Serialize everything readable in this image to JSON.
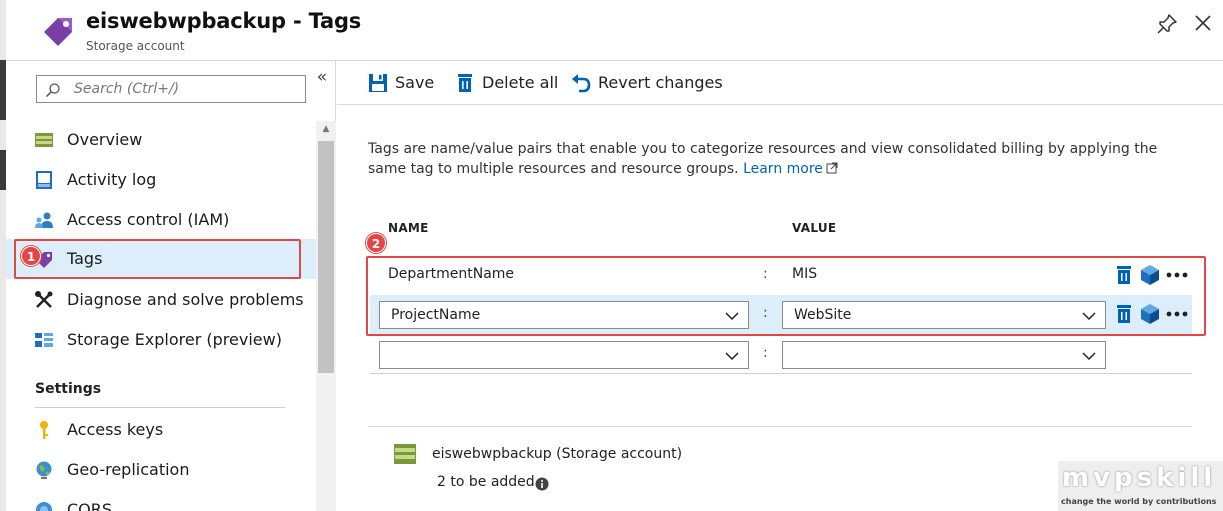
{
  "header": {
    "title": "eiswebwpbackup - Tags",
    "subtitle": "Storage account"
  },
  "sidebar": {
    "search_placeholder": "Search (Ctrl+/)",
    "collapse_glyph": "«",
    "items": [
      {
        "label": "Overview",
        "icon": "storage-overview-icon"
      },
      {
        "label": "Activity log",
        "icon": "activity-log-icon"
      },
      {
        "label": "Access control (IAM)",
        "icon": "people-icon"
      },
      {
        "label": "Tags",
        "icon": "tag-icon",
        "selected": true
      },
      {
        "label": "Diagnose and solve problems",
        "icon": "wrench-icon"
      },
      {
        "label": "Storage Explorer (preview)",
        "icon": "storage-explorer-icon"
      }
    ],
    "section_settings": "Settings",
    "settings_items": [
      {
        "label": "Access keys",
        "icon": "key-icon"
      },
      {
        "label": "Geo-replication",
        "icon": "globe-icon"
      },
      {
        "label": "CORS",
        "icon": "cors-icon"
      }
    ]
  },
  "annotations": {
    "badge1": "1",
    "badge2": "2"
  },
  "toolbar": {
    "save": "Save",
    "delete_all": "Delete all",
    "revert": "Revert changes"
  },
  "content": {
    "description": "Tags are name/value pairs that enable you to categorize resources and view consolidated billing by applying the same tag to multiple resources and resource groups.",
    "learn_more": "Learn more",
    "col_name": "NAME",
    "col_value": "VALUE",
    "separator": ":",
    "tags": [
      {
        "name": "DepartmentName",
        "value": "MIS"
      },
      {
        "name": "ProjectName",
        "value": "WebSite"
      }
    ],
    "new_tag": {
      "name": "",
      "value": ""
    }
  },
  "summary": {
    "resource": "eiswebwpbackup",
    "type": "(Storage account)",
    "count_text": "2 to be added"
  },
  "watermark": {
    "brand": "mvpskill",
    "tagline": "change the world by contributions"
  },
  "colors": {
    "accent": "#0063b1",
    "selected_bg": "#ddeefb",
    "annotation_red": "#e04848",
    "tag_purple": "#7a3fa6"
  }
}
